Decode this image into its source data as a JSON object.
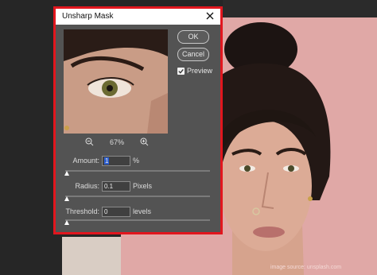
{
  "dialog": {
    "title": "Unsharp Mask",
    "ok_label": "OK",
    "cancel_label": "Cancel",
    "preview_label": "Preview",
    "preview_checked": true,
    "zoom_level": "67%",
    "amount": {
      "label": "Amount:",
      "value": "1",
      "unit": "%"
    },
    "radius": {
      "label": "Radius:",
      "value": "0.1",
      "unit": "Pixels"
    },
    "threshold": {
      "label": "Threshold:",
      "value": "0",
      "unit": "levels"
    }
  },
  "accent_colors": {
    "highlight_border": "#e1161e",
    "dialog_bg": "#535353",
    "canvas_bg": "#e0a8a6"
  },
  "icons": [
    "close-icon",
    "zoom-out-icon",
    "zoom-in-icon",
    "checkbox-checked-icon",
    "slider-thumb-icon"
  ],
  "watermark": "image source: unsplash.com"
}
